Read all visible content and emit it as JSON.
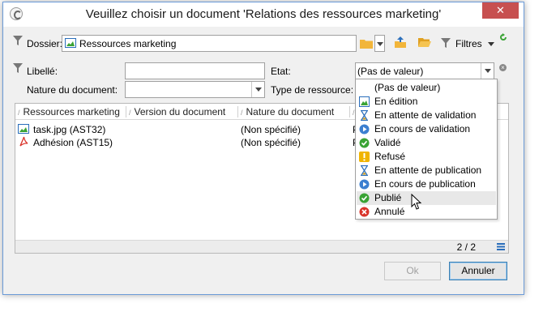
{
  "window": {
    "title": "Veuillez choisir un document 'Relations des ressources marketing'",
    "close": "✕"
  },
  "toolbar": {
    "folder_label": "Dossier:",
    "folder_value": "Ressources marketing",
    "filters_label": "Filtres"
  },
  "filters": {
    "libelle_label": "Libellé:",
    "libelle_value": "",
    "etat_label": "Etat:",
    "etat_value": "(Pas de valeur)",
    "nature_label": "Nature du document:",
    "nature_value": "",
    "type_label": "Type de ressource:"
  },
  "grid": {
    "columns": [
      "Ressources marketing",
      "Version du document",
      "Nature du document",
      "P"
    ],
    "rows": [
      {
        "name": "task.jpg (AST32)",
        "version": "",
        "nature": "(Non spécifié)",
        "p": "P",
        "icon": "image-icon"
      },
      {
        "name": "Adhésion (AST15)",
        "version": "",
        "nature": "(Non spécifié)",
        "p": "P",
        "icon": "pdf-icon"
      }
    ],
    "count": "2 / 2"
  },
  "dropdown": {
    "options": [
      {
        "label": "(Pas de valeur)",
        "icon": "none"
      },
      {
        "label": "En édition",
        "icon": "image-edit-icon"
      },
      {
        "label": "En attente de validation",
        "icon": "hourglass-icon"
      },
      {
        "label": "En cours de validation",
        "icon": "play-circle-icon"
      },
      {
        "label": "Validé",
        "icon": "check-circle-icon"
      },
      {
        "label": "Refusé",
        "icon": "warning-icon"
      },
      {
        "label": "En attente de publication",
        "icon": "hourglass-icon"
      },
      {
        "label": "En cours de publication",
        "icon": "play-circle-icon"
      },
      {
        "label": "Publié",
        "icon": "check-circle-icon"
      },
      {
        "label": "Annulé",
        "icon": "cancel-circle-icon"
      }
    ],
    "hovered": "Publié"
  },
  "buttons": {
    "ok_label": "Ok",
    "cancel_label": "Annuler"
  },
  "colors": {
    "close": "#c75050",
    "accent_blue": "#3c7fb1",
    "green": "#3aa335",
    "red": "#d9342b",
    "yellow": "#f0b400",
    "folder": "#f2b53a"
  }
}
